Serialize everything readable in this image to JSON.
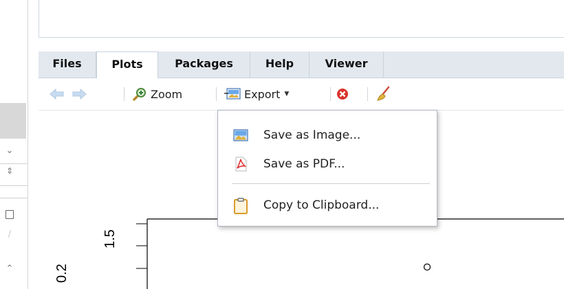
{
  "tabs": [
    {
      "label": "Files"
    },
    {
      "label": "Plots"
    },
    {
      "label": "Packages"
    },
    {
      "label": "Help"
    },
    {
      "label": "Viewer"
    }
  ],
  "active_tab": "Plots",
  "toolbar": {
    "zoom_label": "Zoom",
    "export_label": "Export",
    "icons": [
      "back-arrow-icon",
      "forward-arrow-icon",
      "zoom-icon",
      "export-icon",
      "remove-plot-icon",
      "clear-all-broom-icon"
    ]
  },
  "export_menu": {
    "items": [
      {
        "label": "Save as Image...",
        "icon": "image-icon"
      },
      {
        "label": "Save as PDF...",
        "icon": "pdf-icon"
      },
      {
        "label": "Copy to Clipboard...",
        "icon": "clipboard-icon"
      }
    ]
  },
  "plot": {
    "y_tick_1_5": "1.5",
    "y_tick_0_2": "0.2"
  },
  "colors": {
    "tab_strip": "#e3e8ef",
    "active_tab": "#ffffff",
    "remove_icon": "#d9342b",
    "menu_border": "#aeb5bd"
  }
}
